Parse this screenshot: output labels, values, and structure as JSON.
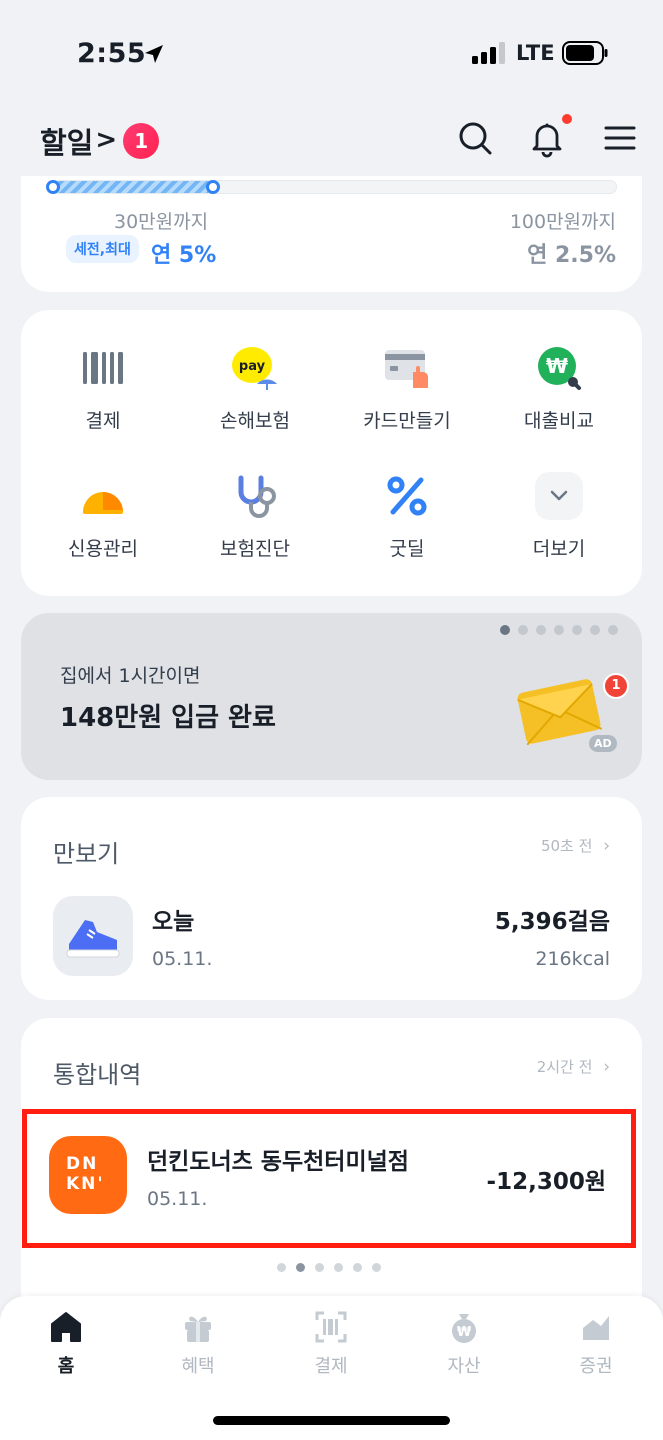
{
  "status_bar": {
    "time": "2:55",
    "network": "LTE"
  },
  "header": {
    "todo_label": "할일",
    "todo_chevron": ">",
    "todo_count": "1"
  },
  "savings": {
    "progress": 0.29,
    "tier1_label": "30만원까지",
    "tier2_label": "100만원까지",
    "badge": "세전,최대",
    "rate1": "연 5%",
    "rate2": "연 2.5%"
  },
  "menu": [
    {
      "label": "결제",
      "icon": "barcode-icon"
    },
    {
      "label": "손해보험",
      "icon": "kakao-pay-umbrella-icon"
    },
    {
      "label": "카드만들기",
      "icon": "card-icon"
    },
    {
      "label": "대출비교",
      "icon": "won-search-icon"
    },
    {
      "label": "신용관리",
      "icon": "gauge-icon"
    },
    {
      "label": "보험진단",
      "icon": "stethoscope-icon"
    },
    {
      "label": "굿딜",
      "icon": "percent-icon"
    },
    {
      "label": "더보기",
      "icon": "chevron-down-icon"
    }
  ],
  "ad": {
    "subtitle": "집에서 1시간이면",
    "title": "148만원 입금 완료",
    "badge_count": "1",
    "ad_label": "AD",
    "page_count": 7,
    "active_page": 0
  },
  "steps": {
    "title": "만보기",
    "time": "50초 전",
    "row_title": "오늘",
    "row_date": "05.11.",
    "steps": "5,396걸음",
    "kcal": "216kcal"
  },
  "history": {
    "title": "통합내역",
    "time": "2시간 전",
    "merchant": "던킨도너츠 동두천터미널점",
    "date": "05.11.",
    "amount": "-12,300원",
    "logo_text_1": "DN",
    "logo_text_2": "KN'",
    "page_count": 6,
    "active_page": 1
  },
  "tabs": [
    {
      "label": "홈",
      "icon": "home-icon",
      "active": true
    },
    {
      "label": "혜택",
      "icon": "gift-icon",
      "active": false
    },
    {
      "label": "결제",
      "icon": "barcode-scan-icon",
      "active": false
    },
    {
      "label": "자산",
      "icon": "money-bag-icon",
      "active": false
    },
    {
      "label": "증권",
      "icon": "chart-icon",
      "active": false
    }
  ],
  "colors": {
    "accent": "#3182f6",
    "badge": "#ff2350",
    "highlight": "#ff1e0f",
    "dunkin": "#ff6a13"
  }
}
